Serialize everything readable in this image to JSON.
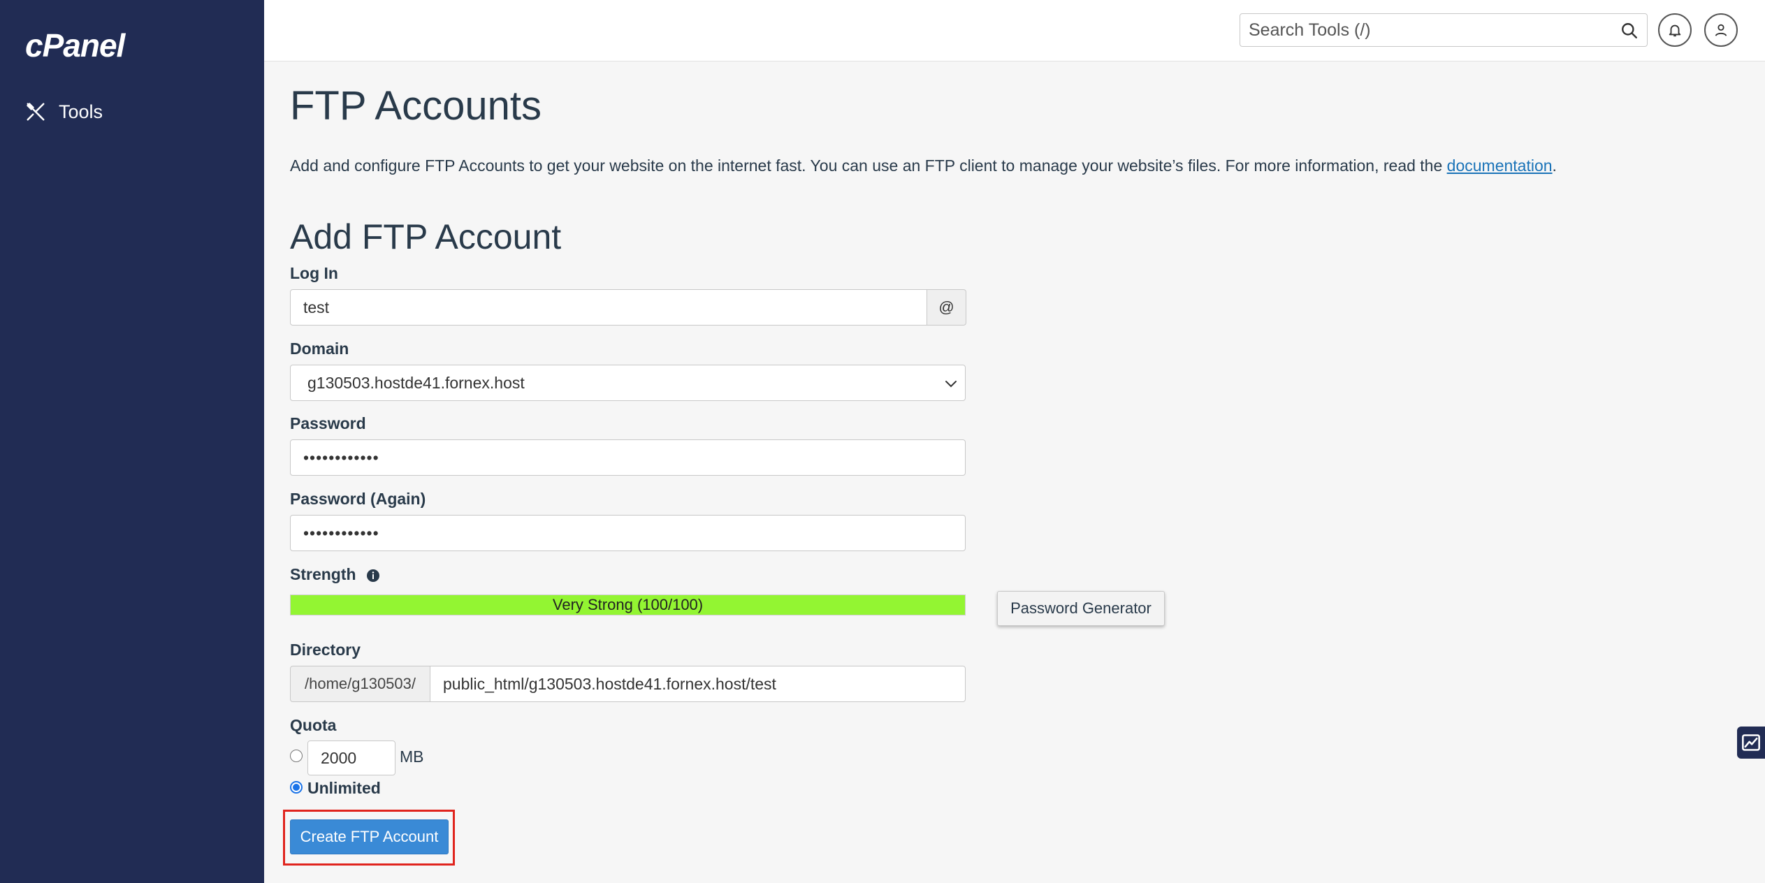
{
  "sidebar": {
    "logo": "cPanel",
    "items": [
      {
        "label": "Tools",
        "icon": "tools-icon"
      }
    ]
  },
  "topbar": {
    "search_placeholder": "Search Tools (/)",
    "icons": [
      "search-icon",
      "bell-icon",
      "user-icon"
    ]
  },
  "page": {
    "title": "FTP Accounts",
    "intro_text": "Add and configure FTP Accounts to get your website on the internet fast. You can use an FTP client to manage your website’s files. For more information, read the ",
    "intro_link": "documentation",
    "intro_end": "."
  },
  "form": {
    "title": "Add FTP Account",
    "login_label": "Log In",
    "login_value": "test",
    "at_symbol": "@",
    "domain_label": "Domain",
    "domain_value": "g130503.hostde41.fornex.host",
    "password_label": "Password",
    "password_value": "••••••••••••",
    "password_again_label": "Password (Again)",
    "password_again_value": "••••••••••••",
    "strength_label": "Strength",
    "strength_text": "Very Strong (100/100)",
    "strength_score": 100,
    "password_generator_label": "Password Generator",
    "directory_label": "Directory",
    "directory_prefix": "/home/g130503/",
    "directory_value": "public_html/g130503.hostde41.fornex.host/test",
    "quota_label": "Quota",
    "quota_value": "2000",
    "quota_unit": "MB",
    "unlimited_label": "Unlimited",
    "quota_selected": "unlimited",
    "create_button_label": "Create FTP Account"
  },
  "colors": {
    "sidebar_bg": "#212c54",
    "strength_bar": "#93f532",
    "primary_button": "#3a8ad6",
    "highlight_border": "#e0241d",
    "link": "#1a73b8"
  }
}
